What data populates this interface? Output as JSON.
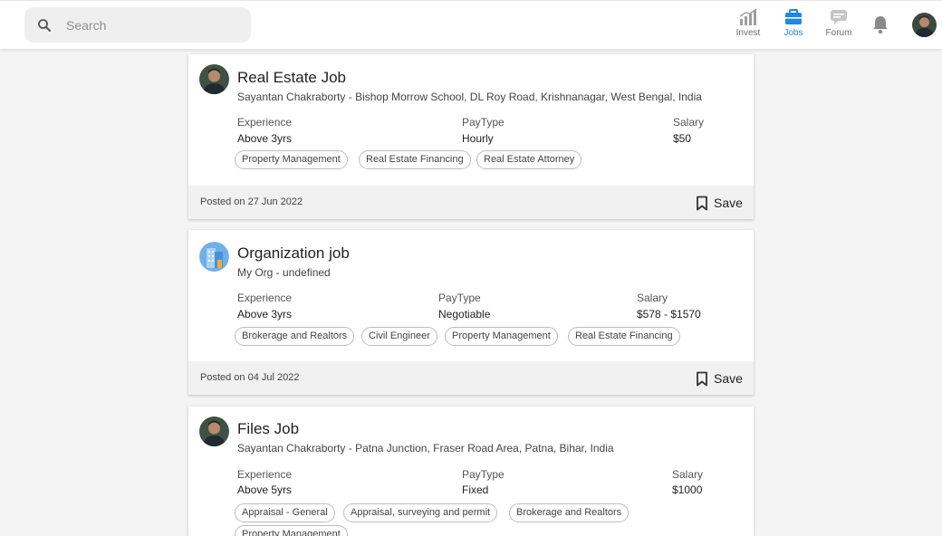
{
  "search": {
    "placeholder": "Search"
  },
  "nav": {
    "invest": "Invest",
    "jobs": "Jobs",
    "forum": "Forum"
  },
  "colors": {
    "accent": "#1e88e5",
    "footer_bg": "#f1f1f1",
    "page_bg": "#f4f4f4"
  },
  "jobs": [
    {
      "title": "Real Estate Job",
      "subtitle": "Sayantan Chakraborty - Bishop Morrow School, DL Roy Road, Krishnanagar, West Bengal, India",
      "experience_label": "Experience",
      "experience": "Above 3yrs",
      "paytype_label": "PayType",
      "paytype": "Hourly",
      "salary_label": "Salary",
      "salary": "$50",
      "tags": [
        "Property Management",
        "Real Estate Financing",
        "Real Estate Attorney"
      ],
      "posted": "Posted on 27 Jun 2022",
      "save_label": "Save"
    },
    {
      "title": "Organization job",
      "subtitle": "My Org - undefined",
      "experience_label": "Experience",
      "experience": "Above 3yrs",
      "paytype_label": "PayType",
      "paytype": "Negotiable",
      "salary_label": "Salary",
      "salary": "$578 - $1570",
      "tags": [
        "Brokerage and Realtors",
        "Civil Engineer",
        "Property Management",
        "Real Estate Financing"
      ],
      "posted": "Posted on 04 Jul 2022",
      "save_label": "Save"
    },
    {
      "title": "Files Job",
      "subtitle": "Sayantan Chakraborty - Patna Junction, Fraser Road Area, Patna, Bihar, India",
      "experience_label": "Experience",
      "experience": "Above 5yrs",
      "paytype_label": "PayType",
      "paytype": "Fixed",
      "salary_label": "Salary",
      "salary": "$1000",
      "tags": [
        "Appraisal - General",
        "Appraisal, surveying and permit",
        "Brokerage and Realtors",
        "Property Management"
      ]
    }
  ]
}
